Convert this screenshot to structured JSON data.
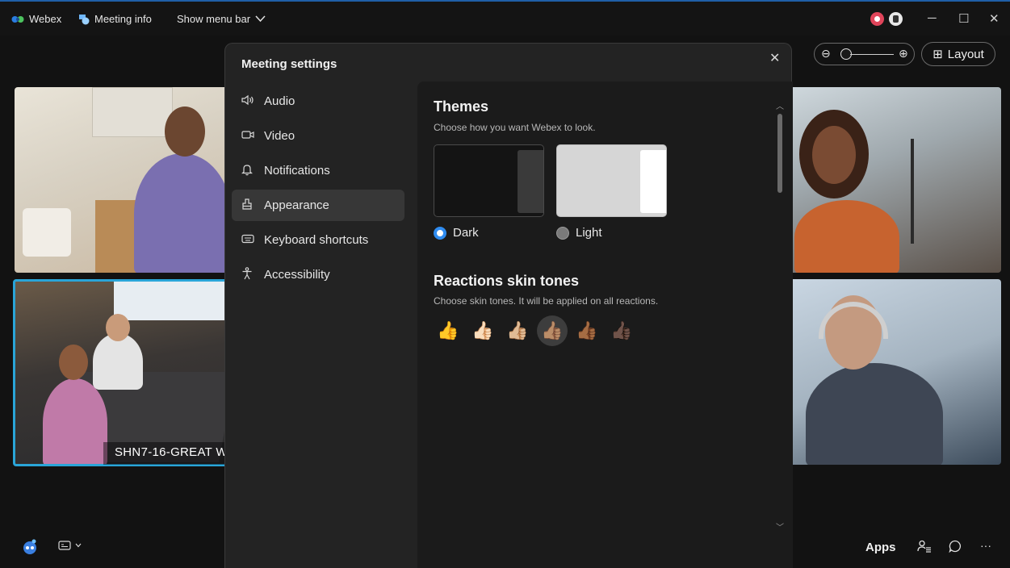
{
  "titlebar": {
    "app_name": "Webex",
    "meeting_info": "Meeting info",
    "show_menu_bar": "Show menu bar"
  },
  "view": {
    "layout_label": "Layout",
    "zoom_out_icon": "zoom-out-icon",
    "zoom_in_icon": "zoom-in-icon"
  },
  "participants": {
    "room_label": "SHN7-16-GREAT WA"
  },
  "dialog": {
    "title": "Meeting settings",
    "nav": [
      {
        "label": "Audio",
        "icon": "speaker-icon"
      },
      {
        "label": "Video",
        "icon": "camera-icon"
      },
      {
        "label": "Notifications",
        "icon": "bell-icon"
      },
      {
        "label": "Appearance",
        "icon": "appearance-icon",
        "active": true
      },
      {
        "label": "Keyboard shortcuts",
        "icon": "keyboard-icon"
      },
      {
        "label": "Accessibility",
        "icon": "accessibility-icon"
      }
    ],
    "themes": {
      "title": "Themes",
      "subtitle": "Choose how you want Webex to look.",
      "options": [
        {
          "label": "Dark",
          "selected": true
        },
        {
          "label": "Light",
          "selected": false
        }
      ]
    },
    "skin_tones": {
      "title": "Reactions skin tones",
      "subtitle": "Choose skin tones. It will be applied on all reactions.",
      "tones": [
        "👍",
        "👍🏻",
        "👍🏼",
        "👍🏽",
        "👍🏾",
        "👍🏿"
      ],
      "selected_index": 3
    }
  },
  "bottombar": {
    "apps_label": "Apps"
  },
  "colors": {
    "accent": "#2f8cf0",
    "active_speaker_border": "#2aa5d8",
    "title_accent": "#1f5fa8"
  }
}
